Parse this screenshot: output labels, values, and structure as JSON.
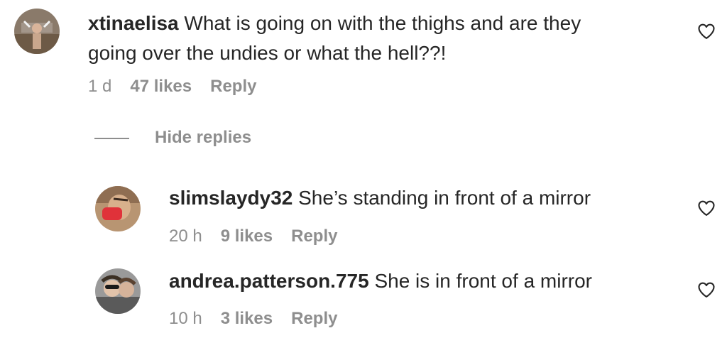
{
  "comments": [
    {
      "username": "xtinaelisa",
      "text_line1": "What is going on with the thighs and are they",
      "text_line2": "going over the undies or what the hell??!",
      "time": "1 d",
      "likes": "47 likes",
      "reply": "Reply"
    },
    {
      "username": "slimslaydy32",
      "text": "She’s standing in front of a mirror",
      "time": "20 h",
      "likes": "9 likes",
      "reply": "Reply"
    },
    {
      "username": "andrea.patterson.775",
      "text": "She is in front of a mirror",
      "time": "10 h",
      "likes": "3 likes",
      "reply": "Reply"
    }
  ],
  "hide_replies": "Hide replies",
  "colors": {
    "text": "#262626",
    "secondary": "#8e8e8e"
  }
}
